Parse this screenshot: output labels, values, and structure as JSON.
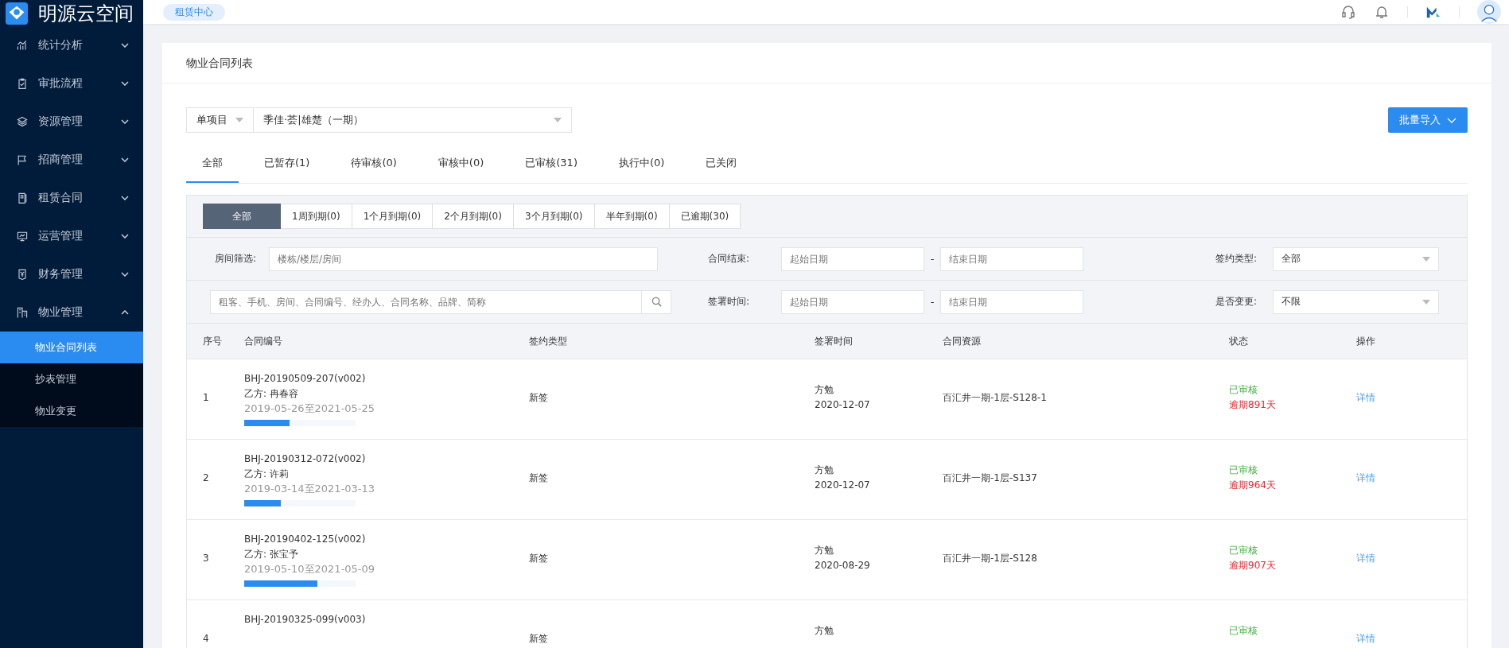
{
  "sidebar": {
    "brand": "明源云空间",
    "items": [
      {
        "label": "统计分析",
        "expanded": false
      },
      {
        "label": "审批流程",
        "expanded": false
      },
      {
        "label": "资源管理",
        "expanded": false
      },
      {
        "label": "招商管理",
        "expanded": false
      },
      {
        "label": "租赁合同",
        "expanded": false
      },
      {
        "label": "运营管理",
        "expanded": false
      },
      {
        "label": "财务管理",
        "expanded": false
      },
      {
        "label": "物业管理",
        "expanded": true,
        "children": [
          {
            "label": "物业合同列表",
            "selected": true
          },
          {
            "label": "抄表管理",
            "selected": false
          },
          {
            "label": "物业变更",
            "selected": false
          }
        ]
      }
    ]
  },
  "header": {
    "tag": "租赁中心"
  },
  "page": {
    "title": "物业合同列表"
  },
  "project_select": {
    "scope": "单项目",
    "project": "季佳·荟|雄楚（一期）"
  },
  "import_button": "批量导入",
  "status_tabs": [
    {
      "label": "全部",
      "selected": true
    },
    {
      "label": "已暂存(1)",
      "selected": false
    },
    {
      "label": "待审核(0)",
      "selected": false
    },
    {
      "label": "审核中(0)",
      "selected": false
    },
    {
      "label": "已审核(31)",
      "selected": false
    },
    {
      "label": "执行中(0)",
      "selected": false
    },
    {
      "label": "已关闭",
      "selected": false
    }
  ],
  "expiry_tabs": [
    {
      "label": "全部",
      "selected": true
    },
    {
      "label": "1周到期(0)",
      "selected": false
    },
    {
      "label": "1个月到期(0)",
      "selected": false
    },
    {
      "label": "2个月到期(0)",
      "selected": false
    },
    {
      "label": "3个月到期(0)",
      "selected": false
    },
    {
      "label": "半年到期(0)",
      "selected": false
    },
    {
      "label": "已逾期(30)",
      "selected": false
    }
  ],
  "filters": [
    {
      "left_label": "房间筛选:",
      "left_placeholder": "楼栋/楼层/房间",
      "date_label": "合同结束:",
      "start_placeholder": "起始日期",
      "separator": "-",
      "end_placeholder": "结束日期",
      "select_label": "签约类型:",
      "select_value": "全部"
    },
    {
      "left_placeholder": "租客、手机、房间、合同编号、经办人、合同名称、品牌、简称",
      "date_label": "签署时间:",
      "start_placeholder": "起始日期",
      "separator": "-",
      "end_placeholder": "结束日期",
      "select_label": "是否变更:",
      "select_value": "不限"
    }
  ],
  "table": {
    "columns": [
      "序号",
      "合同编号",
      "签约类型",
      "签署时间",
      "合同资源",
      "状态",
      "操作"
    ],
    "rows": [
      {
        "no": "1",
        "code": "BHJ-20190509-207(v002)",
        "party": "乙方: 冉春容",
        "period": "2019-05-26至2021-05-25",
        "level": 0.41,
        "sign_type": "新签",
        "signer": "方勉",
        "sign_date": "2020-12-07",
        "resource": "百汇井一期-1层-S128-1",
        "status": "已审核",
        "overdue": "逾期891天",
        "action": "详情"
      },
      {
        "no": "2",
        "code": "BHJ-20190312-072(v002)",
        "party": "乙方: 许莉",
        "period": "2019-03-14至2021-03-13",
        "level": 0.33,
        "sign_type": "新签",
        "signer": "方勉",
        "sign_date": "2020-12-07",
        "resource": "百汇井一期-1层-S137",
        "status": "已审核",
        "overdue": "逾期964天",
        "action": "详情"
      },
      {
        "no": "3",
        "code": "BHJ-20190402-125(v002)",
        "party": "乙方: 张宝予",
        "period": "2019-05-10至2021-05-09",
        "level": 0.66,
        "sign_type": "新签",
        "signer": "方勉",
        "sign_date": "2020-08-29",
        "resource": "百汇井一期-1层-S128",
        "status": "已审核",
        "overdue": "逾期907天",
        "action": "详情"
      },
      {
        "no": "4",
        "code": "BHJ-20190325-099(v003)",
        "sign_type": "新签",
        "signer": "方勉",
        "status": "已审核",
        "action": "详情"
      }
    ]
  }
}
